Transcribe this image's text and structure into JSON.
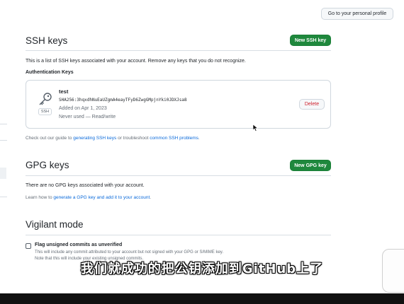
{
  "header": {
    "profile_button": "Go to your personal profile"
  },
  "ssh": {
    "title": "SSH keys",
    "new_button": "New SSH key",
    "description": "This is a list of SSH keys associated with your account. Remove any keys that you do not recognize.",
    "auth_heading": "Authentication Keys",
    "key": {
      "name": "test",
      "fingerprint": "SHA256:3hqxdhNuEaUZgmA4eayTFyD6ZwgGMpjnYki0JDXJsa8",
      "added": "Added on Apr 1, 2023",
      "usage": "Never used — Read/write",
      "badge": "SSH",
      "delete_button": "Delete",
      "icon": "key-icon"
    },
    "guide_prefix": "Check out our guide to ",
    "guide_link": "generating SSH keys",
    "guide_middle": " or troubleshoot ",
    "guide_link2": "common SSH problems",
    "guide_suffix": "."
  },
  "gpg": {
    "title": "GPG keys",
    "new_button": "New GPG key",
    "empty": "There are no GPG keys associated with your account.",
    "learn_prefix": "Learn how to ",
    "learn_link": "generate a GPG key and add it to your account",
    "learn_suffix": "."
  },
  "vigilant": {
    "title": "Vigilant mode",
    "checkbox_label": "Flag unsigned commits as unverified",
    "help1": "This will include any commit attributed to your account but not signed with your GPG or S/MIME key.",
    "help2": "Note that this will include your existing unsigned commits."
  },
  "subtitle": "我们就成功的把公钥添加到GitHub上了",
  "colors": {
    "green": "#1f883d",
    "link": "#0969da",
    "danger": "#cf222e"
  }
}
